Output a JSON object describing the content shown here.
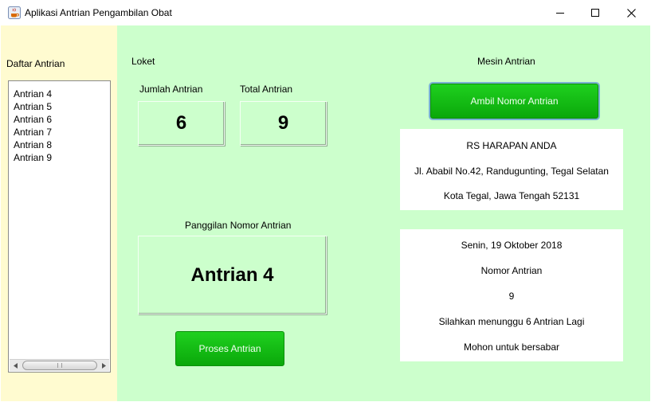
{
  "window": {
    "title": "Aplikasi Antrian Pengambilan Obat",
    "app_icon": "java-cup-icon",
    "controls": [
      "minimize-icon",
      "maximize-icon",
      "close-icon"
    ]
  },
  "sidebar": {
    "heading": "Daftar Antrian",
    "queue": [
      "Antrian 4",
      "Antrian 5",
      "Antrian 6",
      "Antrian 7",
      "Antrian 8",
      "Antrian 9"
    ]
  },
  "loket": {
    "heading": "Loket",
    "jumlah_label": "Jumlah Antrian",
    "jumlah_value": "6",
    "total_label": "Total Antrian",
    "total_value": "9",
    "panggilan_label": "Panggilan Nomor Antrian",
    "panggilan_value": "Antrian 4",
    "proses_button": "Proses Antrian"
  },
  "mesin": {
    "heading": "Mesin Antrian",
    "ambil_button": "Ambil Nomor Antrian",
    "hospital": {
      "name": "RS HARAPAN ANDA",
      "address": "Jl. Ababil No.42, Randugunting, Tegal Selatan",
      "city": "Kota Tegal, Jawa Tengah 52131"
    },
    "ticket": {
      "date": "Senin, 19 Oktober 2018",
      "number_label": "Nomor Antrian",
      "number": "9",
      "wait_message": "Silahkan menunggu 6 Antrian Lagi",
      "closing": "Mohon untuk bersabar"
    }
  },
  "colors": {
    "sidebar_bg": "#fffbd0",
    "main_bg": "#ccffcc",
    "button_green": "#11bb11"
  }
}
